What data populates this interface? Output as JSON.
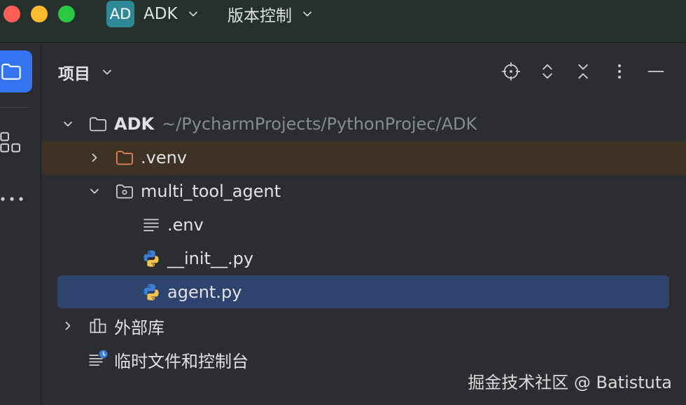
{
  "titlebar": {
    "window_controls": {
      "close_color": "#ff5f57",
      "minimize_color": "#febc2e",
      "zoom_color": "#28c840"
    },
    "project_badge": "AD",
    "project_badge_color": "#2f8896",
    "project_name": "ADK",
    "project_toggle_icon": "chevron-down-icon",
    "vcs_label": "版本控制",
    "vcs_toggle_icon": "chevron-down-icon"
  },
  "tool_strip": {
    "active_color": "#3574f0",
    "items": [
      {
        "icon": "folder-icon",
        "active": true
      },
      {
        "icon": "structure-icon",
        "active": false
      },
      {
        "icon": "more-horizontal-icon",
        "active": false
      }
    ]
  },
  "project_panel": {
    "title": "项目",
    "title_toggle_icon": "chevron-down-icon",
    "actions": [
      {
        "icon": "locate-icon"
      },
      {
        "icon": "expand-all-icon"
      },
      {
        "icon": "collapse-all-icon"
      },
      {
        "icon": "more-vertical-icon"
      },
      {
        "icon": "hide-panel-icon"
      }
    ]
  },
  "tree": [
    {
      "label": "ADK",
      "path": "~/PycharmProjects/PythonProjec/ADK",
      "icon": "folder-icon",
      "toggle_icon": "chevron-down-icon"
    },
    {
      "label": ".venv",
      "icon": "excluded-folder-icon",
      "toggle_icon": "chevron-right-icon",
      "excluded": true
    },
    {
      "label": "multi_tool_agent",
      "icon": "package-folder-icon",
      "toggle_icon": "chevron-down-icon"
    },
    {
      "label": ".env",
      "icon": "text-file-icon"
    },
    {
      "label": "__init__.py",
      "icon": "python-file-icon"
    },
    {
      "label": "agent.py",
      "icon": "python-file-icon",
      "selected": true
    },
    {
      "label": "外部库",
      "icon": "external-libraries-icon",
      "toggle_icon": "chevron-right-icon"
    },
    {
      "label": "临时文件和控制台",
      "icon": "scratches-icon"
    }
  ],
  "colors": {
    "title_bar": "#24302b",
    "selection": "#2e436e",
    "excluded_row": "#3d3223"
  },
  "watermark": "掘金技术社区 @ Batistuta"
}
